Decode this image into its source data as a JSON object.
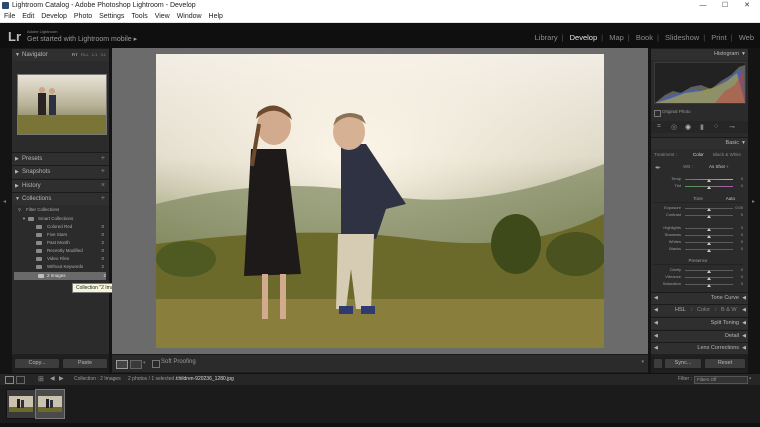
{
  "window": {
    "title": "Lightroom Catalog - Adobe Photoshop Lightroom - Develop",
    "controls": {
      "minimize": "—",
      "maximize": "☐",
      "close": "✕"
    }
  },
  "menubar": [
    "File",
    "Edit",
    "Develop",
    "Photo",
    "Settings",
    "Tools",
    "View",
    "Window",
    "Help"
  ],
  "identity": {
    "logo": "Lr",
    "small_text": "Adobe Lightroom",
    "main_text": "Get started with Lightroom mobile ▸"
  },
  "modules": [
    "Library",
    "Develop",
    "Map",
    "Book",
    "Slideshow",
    "Print",
    "Web"
  ],
  "active_module": "Develop",
  "left_panel": {
    "navigator": {
      "label": "Navigator",
      "modes": [
        "FIT",
        "FILL",
        "1:1",
        "3:1"
      ],
      "active_mode": "FIT"
    },
    "presets": "Presets",
    "snapshots": "Snapshots",
    "history": "History",
    "collections": {
      "label": "Collections",
      "tree": [
        {
          "label": "Filter Collections",
          "count": ""
        },
        {
          "label": "Smart Collections",
          "count": ""
        },
        {
          "label": "Colored Red",
          "count": "0"
        },
        {
          "label": "Five Stars",
          "count": "0"
        },
        {
          "label": "Past Month",
          "count": "2"
        },
        {
          "label": "Recently Modified",
          "count": "0"
        },
        {
          "label": "Video Files",
          "count": "0"
        },
        {
          "label": "Without Keywords",
          "count": "2"
        },
        {
          "label": "2 Images",
          "count": "2"
        }
      ],
      "tooltip": "Collection \"2 Images\""
    },
    "copy_button": "Copy...",
    "paste_button": "Paste"
  },
  "toolbar": {
    "soft_proofing": "Soft Proofing"
  },
  "right_panel": {
    "histogram": "Histogram",
    "original_photo": "Original Photo",
    "basic": {
      "label": "Basic",
      "treatment_label": "Treatment :",
      "treatment_options": [
        "Color",
        "Black & White"
      ],
      "wb_label": "WB :",
      "wb_value": "As Shot ÷",
      "sliders_wb": [
        {
          "label": "Temp",
          "value": "0"
        },
        {
          "label": "Tint",
          "value": "0"
        }
      ],
      "tone_label": "Tone",
      "auto_label": "Auto",
      "sliders_tone": [
        {
          "label": "Exposure",
          "value": "0.00"
        },
        {
          "label": "Contrast",
          "value": "0"
        },
        {
          "label": "Highlights",
          "value": "0"
        },
        {
          "label": "Shadows",
          "value": "0"
        },
        {
          "label": "Whites",
          "value": "0"
        },
        {
          "label": "Blacks",
          "value": "0"
        }
      ],
      "presence_label": "Presence",
      "sliders_presence": [
        {
          "label": "Clarity",
          "value": "0"
        },
        {
          "label": "Vibrance",
          "value": "0"
        },
        {
          "label": "Saturation",
          "value": "0"
        }
      ]
    },
    "tone_curve": "Tone Curve",
    "hsl": [
      "HSL",
      "Color",
      "B & W"
    ],
    "split_toning": "Split Toning",
    "detail": "Detail",
    "lens_corrections": "Lens Corrections",
    "sync_button": "Sync...",
    "reset_button": "Reset"
  },
  "filmstrip": {
    "source": "Collection : 2 Images",
    "info": "2 photos / 1 selected / ",
    "filename": "children-920236_1280.jpg",
    "filter_label": "Filter :",
    "filter_value": "Filters Off"
  }
}
